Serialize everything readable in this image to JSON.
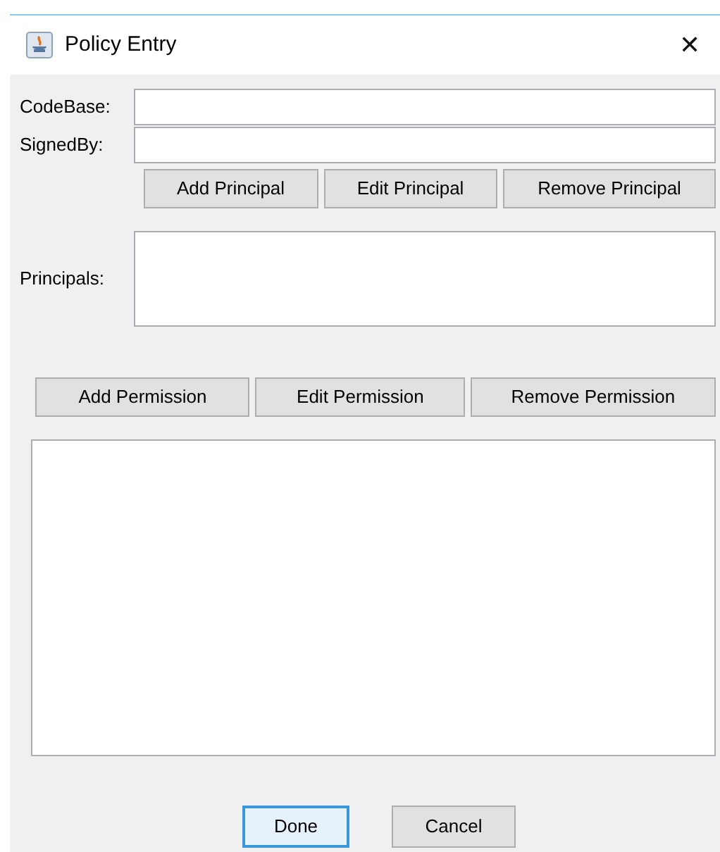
{
  "window": {
    "title": "Policy Entry",
    "close": "✕"
  },
  "fields": [
    {
      "label": "CodeBase:"
    },
    {
      "label": "SignedBy:"
    }
  ],
  "principal_buttons": [
    "Add Principal",
    "Edit Principal",
    "Remove Principal"
  ],
  "principals": {
    "label": "Principals:"
  },
  "permission_buttons": [
    "Add Permission",
    "Edit Permission",
    "Remove Permission"
  ],
  "buttons": [
    {
      "label": "Done",
      "default": true
    },
    {
      "label": "Cancel",
      "default": false
    }
  ]
}
